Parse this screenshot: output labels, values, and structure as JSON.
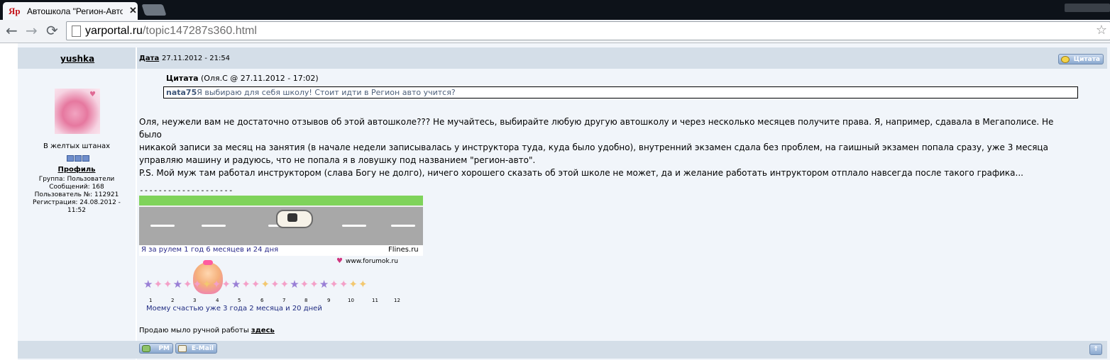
{
  "browser": {
    "favicon": "Яр",
    "tab_title": "Автошкола \"Регион-Авто",
    "tab_close": "✕",
    "url_host": "yarportal.ru",
    "url_path": "/topic147287s360.html"
  },
  "post": {
    "author": "yushka",
    "date_label": "Дата",
    "date_value": "27.11.2012 - 21:54",
    "quote_button": "Цитата",
    "user": {
      "status": "В желтых штанах",
      "profile_link": "Профиль",
      "group": "Группа: Пользователи",
      "messages": "Сообщений: 168",
      "user_number": "Пользователь №: 112921",
      "registration_1": "Регистрация: 24.08.2012 -",
      "registration_2": "11:52"
    },
    "quote": {
      "label": "Цитата",
      "source": "(Оля.С @ 27.11.2012 - 17:02)",
      "inner_author": "nata75",
      "inner_text": "Я выбираю для себя школу! Стоит идти в Регион авто учится?"
    },
    "body_line1": "Оля, неужели вам не достаточно отзывов об этой автошколе??? Не мучайтесь, выбирайте любую другую автошколу и через несколько месяцев получите права. Я, например, сдавала в Мегаполисе. Не было",
    "body_line2": "никакой записи за месяц на занятия (в начале недели записывалась у инструктора туда, куда было удобно), внутренний экзамен сдала без проблем, на гаишный экзамен попала сразу, уже 3 месяца",
    "body_line3": "управляю машину и радуюсь, что не попала я в ловушку под названием \"регион-авто\".",
    "body_line4": "P.S. Мой муж там работал инструктором (слава Богу не долго), ничего хорошего сказать об этой школе не может, да и желание работать интруктором отплало навсегда после такого графика...",
    "signature": {
      "separator": "--------------------",
      "driving_text": "Я за рулем  1 год 6 месяцев и 24 дня",
      "driving_site": "Flines.ru",
      "forumok": "www.forumok.ru",
      "ticker_numbers": [
        "1",
        "2",
        "3",
        "4",
        "5",
        "6",
        "7",
        "8",
        "9",
        "10",
        "11",
        "12"
      ],
      "happiness": "Моему счастью уже 3 года 2 месяца и 20 дней",
      "soap_text": "Продаю мыло ручной работы ",
      "soap_link": "здесь"
    },
    "buttons": {
      "pm": "PM",
      "email": "E-Mail",
      "up": "↑"
    }
  },
  "icons": {
    "back": "back-arrow-icon",
    "forward": "forward-arrow-icon",
    "reload": "reload-icon",
    "bookmark": "star-icon",
    "quote_bubble": "speech-bubble-icon"
  }
}
